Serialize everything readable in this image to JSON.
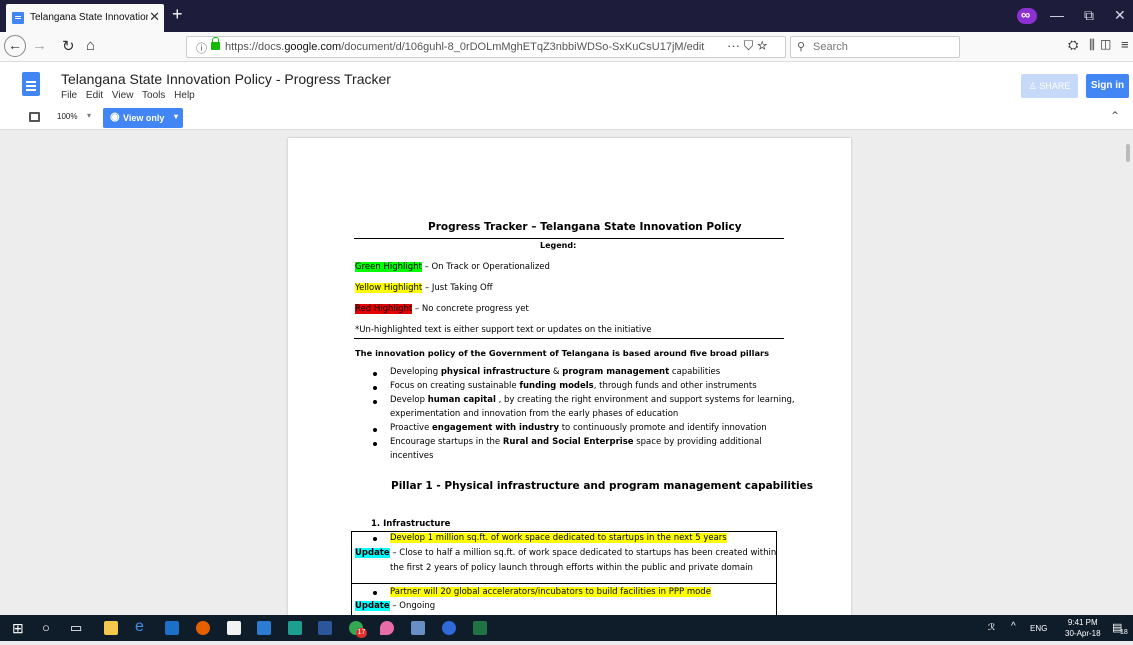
{
  "browser": {
    "tab_title": "Telangana State Innovation Pol",
    "tab_close": "✕",
    "new_tab": "+",
    "url_prefix": "https://docs.",
    "url_domain": "google.com",
    "url_rest": "/document/d/106guhl-8_0rDOLmMghETqZ3nbbiWDSo-SxKuCsU17jM/edit",
    "url_menu": "··· ⛉ ☆",
    "search_placeholder": "Search",
    "window_controls": [
      "—",
      "⧉",
      "✕"
    ]
  },
  "docs": {
    "title": "Telangana State Innovation Policy - Progress Tracker",
    "menu": [
      "File",
      "Edit",
      "View",
      "Tools",
      "Help"
    ],
    "share_label": "SHARE",
    "signin_label": "Sign in",
    "zoom": "100%",
    "view_only_label": "View only"
  },
  "document": {
    "heading": "Progress Tracker – Telangana State Innovation Policy",
    "legend_label": "Legend:",
    "legend": [
      {
        "highlight": "Green Highlight",
        "text": " – On Track or Operationalized"
      },
      {
        "highlight": "Yellow Highlight",
        "text": " – Just Taking Off"
      },
      {
        "highlight": "Red Highlight",
        "text": " – No concrete progress yet"
      }
    ],
    "unhighlighted_note": "*Un-highlighted text is either support text or updates on the initiative",
    "pillars_intro": "The innovation policy of the Government of Telangana is based around five broad pillars",
    "pillars": [
      {
        "pre": "Developing ",
        "bold": "physical infrastructure",
        "mid": " & ",
        "bold2": "program management",
        "post": " capabilities"
      },
      {
        "pre": "Focus on creating sustainable ",
        "bold": "funding models",
        "post": ", through funds and other instruments"
      },
      {
        "pre": "Develop ",
        "bold": "human capital",
        "post": " , by creating the right environment and support systems for learning,",
        "post2": "experimentation and innovation from the early phases of education"
      },
      {
        "pre": "Proactive ",
        "bold": "engagement with industry",
        "post": " to continuously promote and identify innovation"
      },
      {
        "pre": "Encourage startups in the ",
        "bold": "Rural and Social Enterprise",
        "post": " space by providing additional",
        "post2": "incentives"
      }
    ],
    "pillar1_heading": "Pillar 1 - Physical infrastructure and program management capabilities",
    "section1_heading": "1.  Infrastructure",
    "item1": "Develop 1 million sq.ft. of work space dedicated to startups in the next 5 years",
    "update_label": "Update",
    "update1_line1": " – Close to half a million sq.ft. of work space dedicated to startups has been created within",
    "update1_line2": "the first 2 years of policy launch through efforts within the public and private domain",
    "item2": "Partner will 20 global accelerators/incubators to build facilities in PPP mode",
    "update2": " – Ongoing"
  },
  "taskbar": {
    "tray_lang": "ENG",
    "time": "9:41 PM",
    "date": "30-Apr-18",
    "badge_count": "17",
    "notif_count": "18"
  }
}
